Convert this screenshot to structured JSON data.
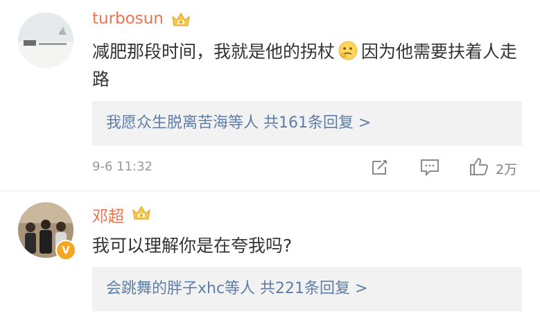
{
  "comments": [
    {
      "username": "turbosun",
      "text_part1": "减肥那段时间，我就是他的拐杖",
      "text_part2": "因为他需要扶着人走路",
      "emoji": "thinking-face-icon",
      "replies": "我愿众生脱离苦海等人  共161条回复 >",
      "time": "9-6 11:32",
      "likes": "2万"
    },
    {
      "username": "邓超",
      "text": "我可以理解你是在夸我吗?",
      "verified_badge": "V",
      "replies": "会跳舞的胖子xhc等人  共221条回复 >"
    }
  ],
  "colors": {
    "username": "#eb7350",
    "reply_link": "#5d7da8",
    "reply_bg": "#f2f2f2",
    "meta": "#999999",
    "crown": "#f2c94c"
  }
}
